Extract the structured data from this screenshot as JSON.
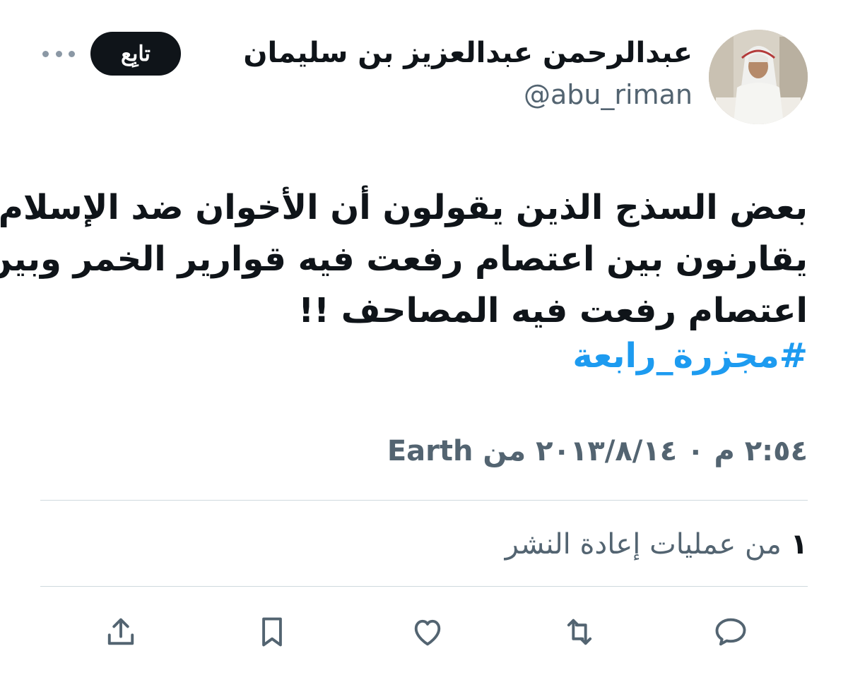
{
  "author": {
    "display_name": "عبدالرحمن عبدالعزيز بن سليمان",
    "handle": "@abu_riman"
  },
  "follow_label": "تابِع",
  "tweet": {
    "lines": [
      "بعض السذج الذين يقولون أن الأخوان ضد الإسلام",
      "يقارنون بين اعتصام رفعت فيه قوارير الخمر وبين",
      "اعتصام رفعت فيه المصاحف !!"
    ],
    "hashtag": "#مجزرة_رابعة"
  },
  "meta": "٢:٥٤ م ۰ ٢٠١٣/٨/١٤ من Earth",
  "retweets": {
    "count": "١",
    "label": "من عمليات إعادة النشر"
  },
  "actions": [
    "reply-icon",
    "retweet-icon",
    "like-icon",
    "bookmark-icon",
    "share-icon"
  ],
  "colors": {
    "text": "#0f1419",
    "secondary": "#536471",
    "link": "#1d9bf0",
    "divider": "#cfd9de"
  }
}
